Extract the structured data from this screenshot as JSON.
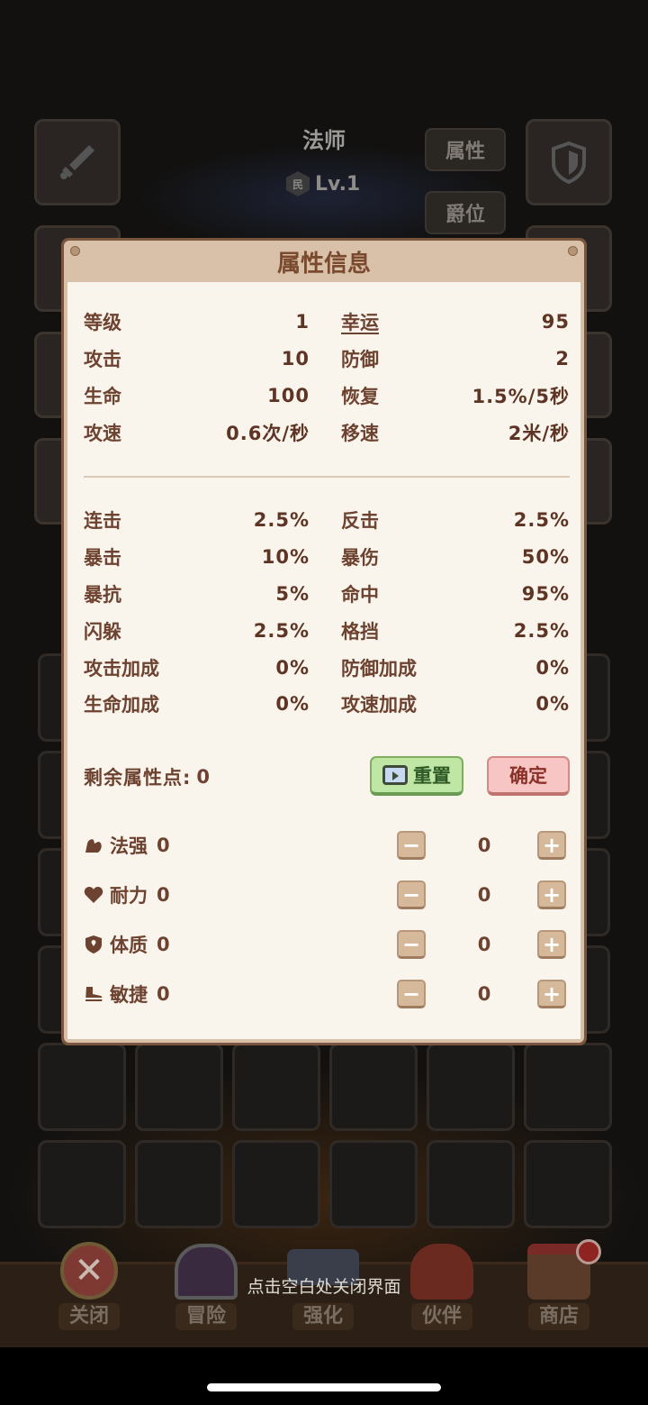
{
  "background": {
    "class_name": "法师",
    "rank_badge": "民",
    "level": "Lv.1",
    "side_buttons": [
      "属性",
      "爵位"
    ]
  },
  "dialog": {
    "title": "属性信息",
    "base_stats": [
      {
        "name": "等级",
        "value": "1"
      },
      {
        "name": "幸运",
        "value": "95"
      },
      {
        "name": "攻击",
        "value": "10"
      },
      {
        "name": "防御",
        "value": "2"
      },
      {
        "name": "生命",
        "value": "100"
      },
      {
        "name": "恢复",
        "value": "1.5%/5秒"
      },
      {
        "name": "攻速",
        "value": "0.6次/秒"
      },
      {
        "name": "移速",
        "value": "2米/秒"
      }
    ],
    "advanced_stats": [
      {
        "name": "连击",
        "value": "2.5%"
      },
      {
        "name": "反击",
        "value": "2.5%"
      },
      {
        "name": "暴击",
        "value": "10%"
      },
      {
        "name": "暴伤",
        "value": "50%"
      },
      {
        "name": "暴抗",
        "value": "5%"
      },
      {
        "name": "命中",
        "value": "95%"
      },
      {
        "name": "闪躲",
        "value": "2.5%"
      },
      {
        "name": "格挡",
        "value": "2.5%"
      },
      {
        "name": "攻击加成",
        "value": "0%"
      },
      {
        "name": "防御加成",
        "value": "0%"
      },
      {
        "name": "生命加成",
        "value": "0%"
      },
      {
        "name": "攻速加成",
        "value": "0%"
      }
    ],
    "remaining_points_label": "剩余属性点:",
    "remaining_points": "0",
    "reset_label": "重置",
    "confirm_label": "确定",
    "allocations": [
      {
        "name": "法强",
        "base": "0",
        "value": "0",
        "icon": "flexed-arm-icon"
      },
      {
        "name": "耐力",
        "base": "0",
        "value": "0",
        "icon": "heart-icon"
      },
      {
        "name": "体质",
        "base": "0",
        "value": "0",
        "icon": "shield-icon"
      },
      {
        "name": "敏捷",
        "base": "0",
        "value": "0",
        "icon": "boot-icon"
      }
    ],
    "minus_symbol": "−",
    "plus_symbol": "+"
  },
  "hint": "点击空白处关闭界面",
  "bottom_nav": [
    {
      "label": "关闭"
    },
    {
      "label": "冒险"
    },
    {
      "label": "强化"
    },
    {
      "label": "伙伴"
    },
    {
      "label": "商店"
    }
  ]
}
